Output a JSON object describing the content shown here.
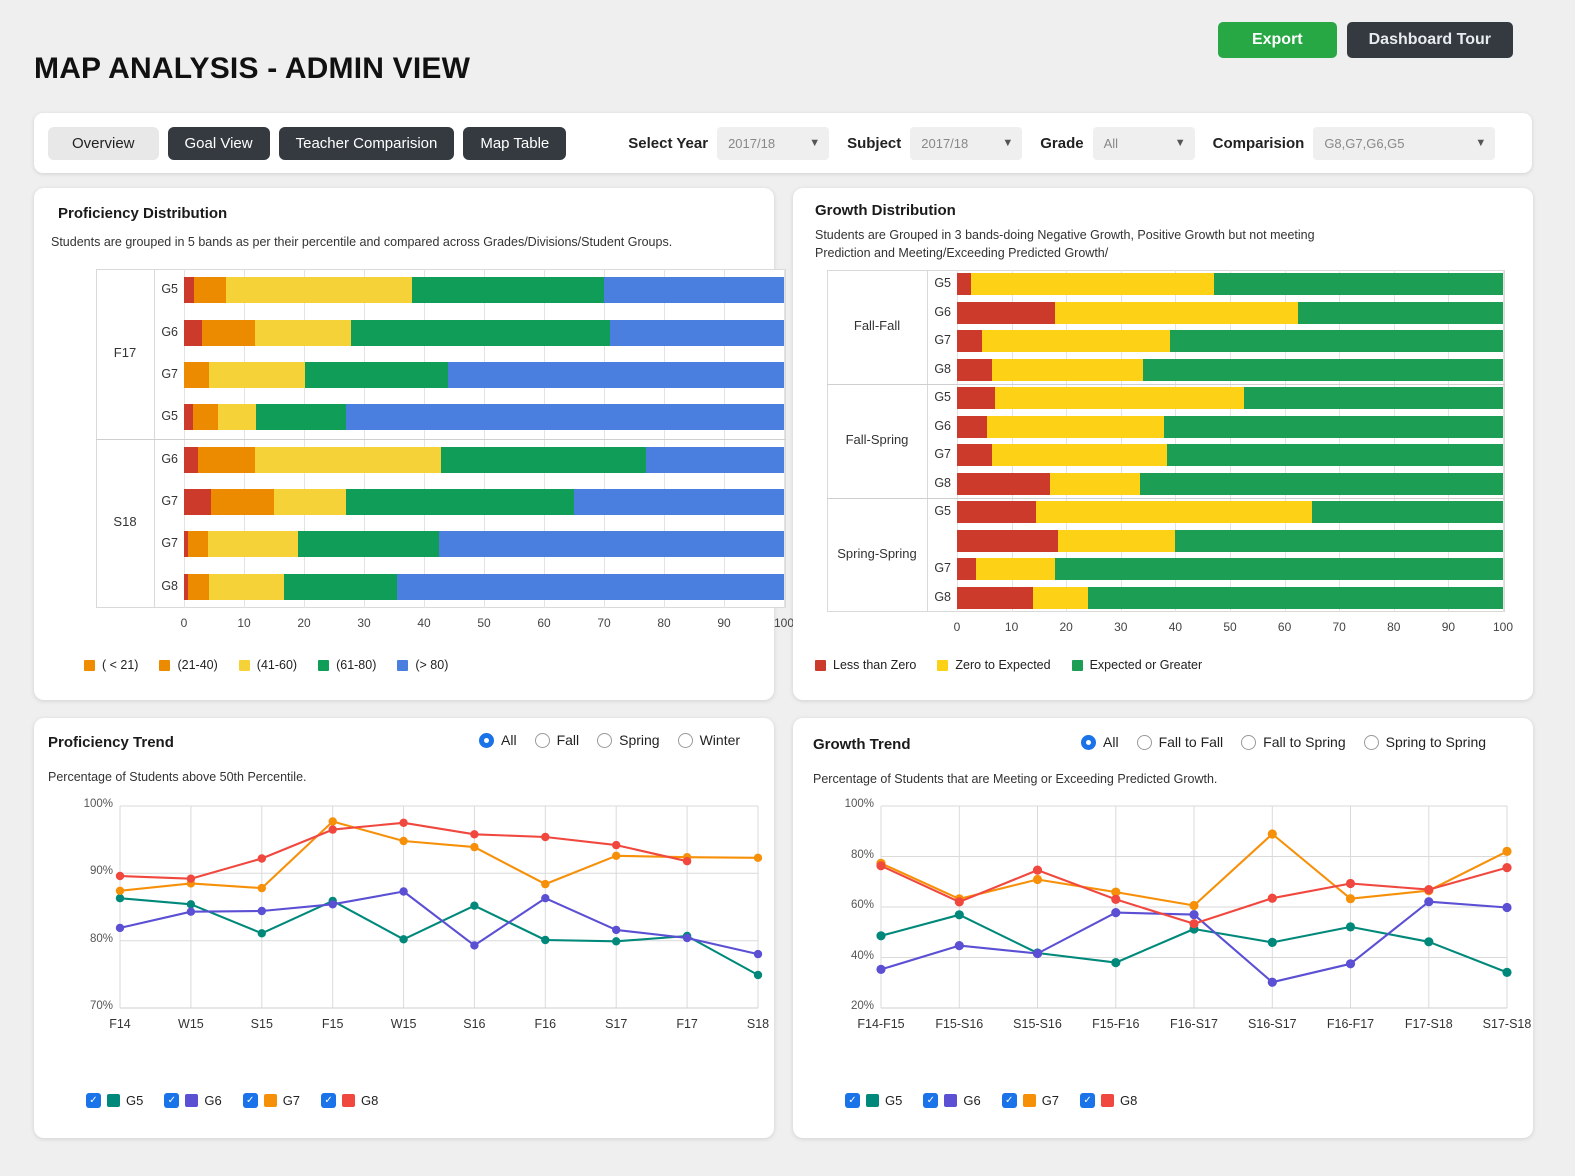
{
  "header": {
    "title": "MAP ANALYSIS  - ADMIN VIEW",
    "export_label": "Export",
    "tour_label": "Dashboard Tour"
  },
  "tabs": [
    {
      "label": "Overview",
      "active": true
    },
    {
      "label": "Goal View",
      "active": false
    },
    {
      "label": "Teacher Comparision",
      "active": false
    },
    {
      "label": "Map Table",
      "active": false
    }
  ],
  "filters": [
    {
      "label": "Select Year",
      "value": "2017/18",
      "name": "select-year"
    },
    {
      "label": "Subject",
      "value": "2017/18",
      "name": "subject"
    },
    {
      "label": "Grade",
      "value": "All",
      "name": "grade"
    },
    {
      "label": "Comparision",
      "value": "G8,G7,G6,G5",
      "name": "comparision"
    }
  ],
  "proficiency_distribution": {
    "title": "Proficiency Distribution",
    "subtitle": "Students are grouped in 5 bands as per their percentile and compared across Grades/Divisions/Student Groups."
  },
  "growth_distribution": {
    "title": "Growth Distribution",
    "subtitle": "Students are Grouped  in 3 bands-doing Negative Growth, Positive Growth but not meeting Prediction and Meeting/Exceeding Predicted Growth/"
  },
  "proficiency_trend": {
    "title": "Proficiency Trend",
    "subtitle": "Percentage of Students above 50th Percentile.",
    "radios": [
      {
        "label": "All",
        "selected": true
      },
      {
        "label": "Fall",
        "selected": false
      },
      {
        "label": "Spring",
        "selected": false
      },
      {
        "label": "Winter",
        "selected": false
      }
    ]
  },
  "growth_trend": {
    "title": "Growth Trend",
    "subtitle": "Percentage of Students that are Meeting or Exceeding Predicted Growth.",
    "radios": [
      {
        "label": "All",
        "selected": true
      },
      {
        "label": "Fall to Fall",
        "selected": false
      },
      {
        "label": "Fall to Spring",
        "selected": false
      },
      {
        "label": "Spring to Spring",
        "selected": false
      }
    ]
  },
  "series_legend": [
    {
      "label": "G5",
      "color": "#00897b",
      "checked": true
    },
    {
      "label": "G6",
      "color": "#5b4fd4",
      "checked": true
    },
    {
      "label": "G7",
      "color": "#f79009",
      "checked": true
    },
    {
      "label": "G8",
      "color": "#f0483e",
      "checked": true
    }
  ],
  "chart_data": [
    {
      "type": "bar",
      "id": "proficiency-distribution",
      "orientation": "horizontal",
      "stacked": true,
      "title": "Proficiency Distribution",
      "xlabel": "",
      "ylabel": "",
      "xlim": [
        0,
        100
      ],
      "xticks": [
        0,
        10,
        20,
        30,
        40,
        50,
        60,
        70,
        80,
        90,
        100
      ],
      "grid": true,
      "legend_position": "bottom",
      "legend": [
        {
          "label": "( < 21)",
          "color": "#f08c00"
        },
        {
          "label": "(21-40)",
          "color": "#ed8b00"
        },
        {
          "label": "(41-60)",
          "color": "#f6d239"
        },
        {
          "label": "(61-80)",
          "color": "#0f9d58"
        },
        {
          "label": "(> 80)",
          "color": "#4a7fe0"
        }
      ],
      "series": [
        {
          "name": "( < 21)",
          "color": "#cc3a2b",
          "values": [
            1.6,
            3.0,
            0.0,
            1.5,
            2.4,
            4.5,
            0.7,
            0.7
          ]
        },
        {
          "name": "(21-40)",
          "color": "#ed8b00",
          "values": [
            5.4,
            8.9,
            4.1,
            4.2,
            9.5,
            10.5,
            3.3,
            3.5
          ]
        },
        {
          "name": "(41-60)",
          "color": "#f6d239",
          "values": [
            31.0,
            15.9,
            16.0,
            6.3,
            31.0,
            12.0,
            15.0,
            12.5
          ]
        },
        {
          "name": "(61-80)",
          "color": "#0f9d58",
          "values": [
            32.0,
            43.2,
            23.9,
            15.0,
            34.1,
            38.0,
            23.5,
            18.8
          ]
        },
        {
          "name": "(> 80)",
          "color": "#4a7fe0",
          "values": [
            30.0,
            29.0,
            56.0,
            73.0,
            23.0,
            35.0,
            57.5,
            64.5
          ]
        }
      ],
      "groups": [
        {
          "label": "F17",
          "rows": [
            "G5",
            "G6",
            "G7",
            "G5"
          ]
        },
        {
          "label": "S18",
          "rows": [
            "G6",
            "G7",
            "G7",
            "G8"
          ]
        }
      ],
      "categories": [
        "G5",
        "G6",
        "G7",
        "G5",
        "G6",
        "G7",
        "G7",
        "G8"
      ]
    },
    {
      "type": "bar",
      "id": "growth-distribution",
      "orientation": "horizontal",
      "stacked": true,
      "title": "Growth Distribution",
      "xlabel": "",
      "ylabel": "",
      "xlim": [
        0,
        100
      ],
      "xticks": [
        0,
        10,
        20,
        30,
        40,
        50,
        60,
        70,
        80,
        90,
        100
      ],
      "grid": true,
      "legend_position": "bottom",
      "legend": [
        {
          "label": "Less than Zero",
          "color": "#cc3a2b"
        },
        {
          "label": "Zero to Expected",
          "color": "#fcd116"
        },
        {
          "label": "Expected or Greater",
          "color": "#1c9e55"
        }
      ],
      "series": [
        {
          "name": "Less than Zero",
          "color": "#cc3a2b",
          "values": [
            2.5,
            18.0,
            4.5,
            6.5,
            7.0,
            5.5,
            6.5,
            17.0,
            14.5,
            18.5,
            3.5,
            14.0
          ]
        },
        {
          "name": "Zero to Expected",
          "color": "#fcd116",
          "values": [
            44.5,
            44.5,
            34.5,
            27.5,
            45.5,
            32.5,
            32.0,
            16.5,
            50.5,
            21.5,
            14.5,
            10.0
          ]
        },
        {
          "name": "Expected or Greater",
          "color": "#1c9e55",
          "values": [
            53.0,
            37.5,
            61.0,
            66.0,
            47.5,
            62.0,
            61.5,
            66.5,
            35.0,
            60.0,
            82.0,
            76.0
          ]
        }
      ],
      "groups": [
        {
          "label": "Fall-Fall",
          "rows": [
            "G5",
            "G6",
            "G7",
            "G8"
          ]
        },
        {
          "label": "Fall-Spring",
          "rows": [
            "G5",
            "G6",
            "G7",
            "G8"
          ]
        },
        {
          "label": "Spring-Spring",
          "rows": [
            "G5",
            "",
            "G7",
            "G8"
          ]
        }
      ],
      "categories": [
        "G5",
        "G6",
        "G7",
        "G8",
        "G5",
        "G6",
        "G7",
        "G8",
        "G5",
        "",
        "G7",
        "G8"
      ]
    },
    {
      "type": "line",
      "id": "proficiency-trend",
      "title": "Proficiency Trend",
      "subtitle": "Percentage of Students above 50th Percentile.",
      "xlabel": "",
      "ylabel": "",
      "ylim": [
        70,
        100
      ],
      "yticks": [
        70,
        80,
        90,
        100
      ],
      "ytick_labels": [
        "70%",
        "80%",
        "90%",
        "100%"
      ],
      "grid": true,
      "legend_position": "bottom",
      "x": [
        "F14",
        "W15",
        "S15",
        "F15",
        "W15",
        "S16",
        "F16",
        "S17",
        "F17",
        "S18"
      ],
      "series": [
        {
          "name": "G5",
          "color": "#00897b",
          "values": [
            86.3,
            85.4,
            81.1,
            85.9,
            80.2,
            85.2,
            80.1,
            79.9,
            80.7,
            74.9
          ]
        },
        {
          "name": "G6",
          "color": "#5b4fd4",
          "values": [
            81.9,
            84.3,
            84.4,
            85.4,
            87.3,
            79.3,
            86.3,
            81.6,
            80.4,
            78.0
          ]
        },
        {
          "name": "G7",
          "color": "#f79009",
          "values": [
            87.4,
            88.5,
            87.8,
            97.7,
            94.8,
            93.9,
            88.4,
            92.6,
            92.4,
            92.3
          ]
        },
        {
          "name": "G8",
          "color": "#f0483e",
          "values": [
            89.6,
            89.2,
            92.2,
            96.5,
            97.5,
            95.8,
            95.4,
            94.2,
            91.8,
            null
          ]
        }
      ]
    },
    {
      "type": "line",
      "id": "growth-trend",
      "title": "Growth Trend",
      "subtitle": "Percentage of Students that are Meeting or Exceeding Predicted Growth.",
      "xlabel": "",
      "ylabel": "",
      "ylim": [
        20,
        100
      ],
      "yticks": [
        20,
        40,
        60,
        80,
        100
      ],
      "ytick_labels": [
        "20%",
        "40%",
        "60%",
        "80%",
        "100%"
      ],
      "grid": true,
      "legend_position": "bottom",
      "x": [
        "F14-F15",
        "F15-S16",
        "S15-S16",
        "F15-F16",
        "F16-S17",
        "S16-S17",
        "F16-F17",
        "F17-S18",
        "S17-S18"
      ],
      "series": [
        {
          "name": "G5",
          "color": "#00897b",
          "values": [
            48.6,
            56.9,
            41.8,
            38.0,
            51.3,
            46.0,
            52.1,
            46.2,
            34.1
          ]
        },
        {
          "name": "G6",
          "color": "#5b4fd4",
          "values": [
            35.3,
            44.7,
            41.6,
            57.8,
            57.0,
            30.2,
            37.5,
            62.1,
            59.8
          ]
        },
        {
          "name": "G7",
          "color": "#f79009",
          "values": [
            77.3,
            63.2,
            70.9,
            65.9,
            60.6,
            88.9,
            63.3,
            66.5,
            82.0
          ]
        },
        {
          "name": "G8",
          "color": "#f0483e",
          "values": [
            76.3,
            62.0,
            74.6,
            63.0,
            53.4,
            63.5,
            69.3,
            66.9,
            75.6
          ]
        }
      ]
    }
  ]
}
